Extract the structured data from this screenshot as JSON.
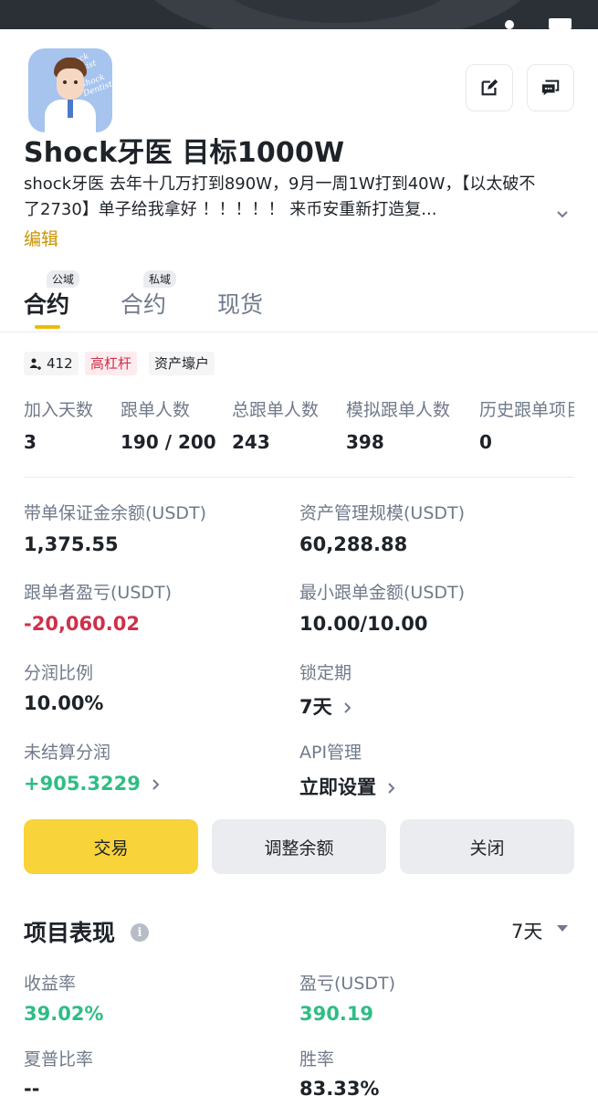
{
  "profile": {
    "name": "Shock牙医 目标1000W",
    "bio": "shock牙医 去年十几万打到890W，9月一周1W打到40W，【以太破不了2730】单子给我拿好 ！！！！！ 来币安重新打造复...",
    "edit_label": "编辑",
    "avatar_watermark": "Shock Dentist"
  },
  "tabs": [
    {
      "label": "合约",
      "badge": "公域",
      "active": true
    },
    {
      "label": "合约",
      "badge": "私域",
      "active": false
    },
    {
      "label": "现货",
      "badge": "",
      "active": false
    }
  ],
  "chips": [
    {
      "label": "412",
      "icon": "users-icon"
    },
    {
      "label": "高杠杆",
      "color": "#cf304a"
    },
    {
      "label": "资产壕户"
    }
  ],
  "stats": [
    {
      "label": "加入天数",
      "value": "3"
    },
    {
      "label": "跟单人数",
      "value": "190 / 200"
    },
    {
      "label": "总跟单人数",
      "value": "243"
    },
    {
      "label": "模拟跟单人数",
      "value": "398"
    },
    {
      "label": "历史跟单项目",
      "value": "0"
    }
  ],
  "metrics": {
    "margin_balance": {
      "label": "带单保证金余额(USDT)",
      "value": "1,375.55"
    },
    "aum": {
      "label": "资产管理规模(USDT)",
      "value": "60,288.88"
    },
    "follower_pnl": {
      "label": "跟单者盈亏(USDT)",
      "value": "-20,060.02"
    },
    "min_copy": {
      "label": "最小跟单金额(USDT)",
      "value": "10.00/10.00"
    },
    "profit_share": {
      "label": "分润比例",
      "value": "10.00%"
    },
    "lock_period": {
      "label": "锁定期",
      "value": "7天"
    },
    "unsettled": {
      "label": "未结算分润",
      "value": "+905.3229"
    },
    "api": {
      "label": "API管理",
      "value": "立即设置"
    }
  },
  "buttons": {
    "trade": "交易",
    "adjust": "调整余额",
    "close": "关闭"
  },
  "performance": {
    "title": "项目表现",
    "period": "7天",
    "roi_label": "收益率",
    "roi_value": "39.02%",
    "pnl_label": "盈亏(USDT)",
    "pnl_value": "390.19",
    "sharpe_label": "夏普比率",
    "sharpe_value": "--",
    "winrate_label": "胜率",
    "winrate_value": "83.33%"
  },
  "colors": {
    "accent": "#f0b90b",
    "primary_button": "#f8d33a",
    "positive": "#2ebd85",
    "negative": "#cf304a",
    "edit_link": "#c99400"
  }
}
